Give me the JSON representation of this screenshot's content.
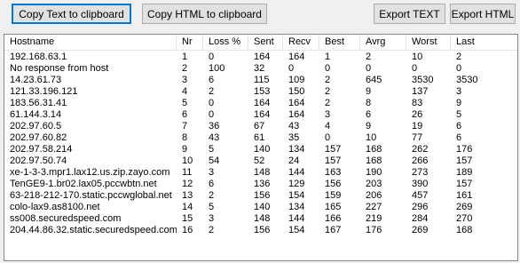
{
  "toolbar": {
    "copy_text_label": "Copy Text to clipboard",
    "copy_html_label": "Copy HTML to clipboard",
    "export_text_label": "Export TEXT",
    "export_html_label": "Export HTML"
  },
  "table": {
    "columns": [
      "Hostname",
      "Nr",
      "Loss %",
      "Sent",
      "Recv",
      "Best",
      "Avrg",
      "Worst",
      "Last"
    ],
    "rows": [
      [
        "192.168.63.1",
        "1",
        "0",
        "164",
        "164",
        "1",
        "2",
        "10",
        "2"
      ],
      [
        "No response from host",
        "2",
        "100",
        "32",
        "0",
        "0",
        "0",
        "0",
        "0"
      ],
      [
        "14.23.61.73",
        "3",
        "6",
        "115",
        "109",
        "2",
        "645",
        "3530",
        "3530"
      ],
      [
        "121.33.196.121",
        "4",
        "2",
        "153",
        "150",
        "2",
        "9",
        "137",
        "3"
      ],
      [
        "183.56.31.41",
        "5",
        "0",
        "164",
        "164",
        "2",
        "8",
        "83",
        "9"
      ],
      [
        "61.144.3.14",
        "6",
        "0",
        "164",
        "164",
        "3",
        "6",
        "26",
        "5"
      ],
      [
        "202.97.60.5",
        "7",
        "36",
        "67",
        "43",
        "4",
        "9",
        "19",
        "6"
      ],
      [
        "202.97.60.82",
        "8",
        "43",
        "61",
        "35",
        "0",
        "10",
        "77",
        "6"
      ],
      [
        "202.97.58.214",
        "9",
        "5",
        "140",
        "134",
        "157",
        "168",
        "262",
        "176"
      ],
      [
        "202.97.50.74",
        "10",
        "54",
        "52",
        "24",
        "157",
        "168",
        "266",
        "157"
      ],
      [
        "xe-1-3-3.mpr1.lax12.us.zip.zayo.com",
        "11",
        "3",
        "148",
        "144",
        "163",
        "190",
        "273",
        "189"
      ],
      [
        "TenGE9-1.br02.lax05.pccwbtn.net",
        "12",
        "6",
        "136",
        "129",
        "156",
        "203",
        "390",
        "157"
      ],
      [
        "63-218-212-170.static.pccwglobal.net",
        "13",
        "2",
        "156",
        "154",
        "159",
        "206",
        "457",
        "161"
      ],
      [
        "colo-lax9.as8100.net",
        "14",
        "5",
        "140",
        "134",
        "165",
        "227",
        "296",
        "269"
      ],
      [
        "ss008.securedspeed.com",
        "15",
        "3",
        "148",
        "144",
        "166",
        "219",
        "284",
        "270"
      ],
      [
        "204.44.86.32.static.securedspeed.com",
        "16",
        "2",
        "156",
        "154",
        "167",
        "176",
        "269",
        "168"
      ]
    ]
  }
}
